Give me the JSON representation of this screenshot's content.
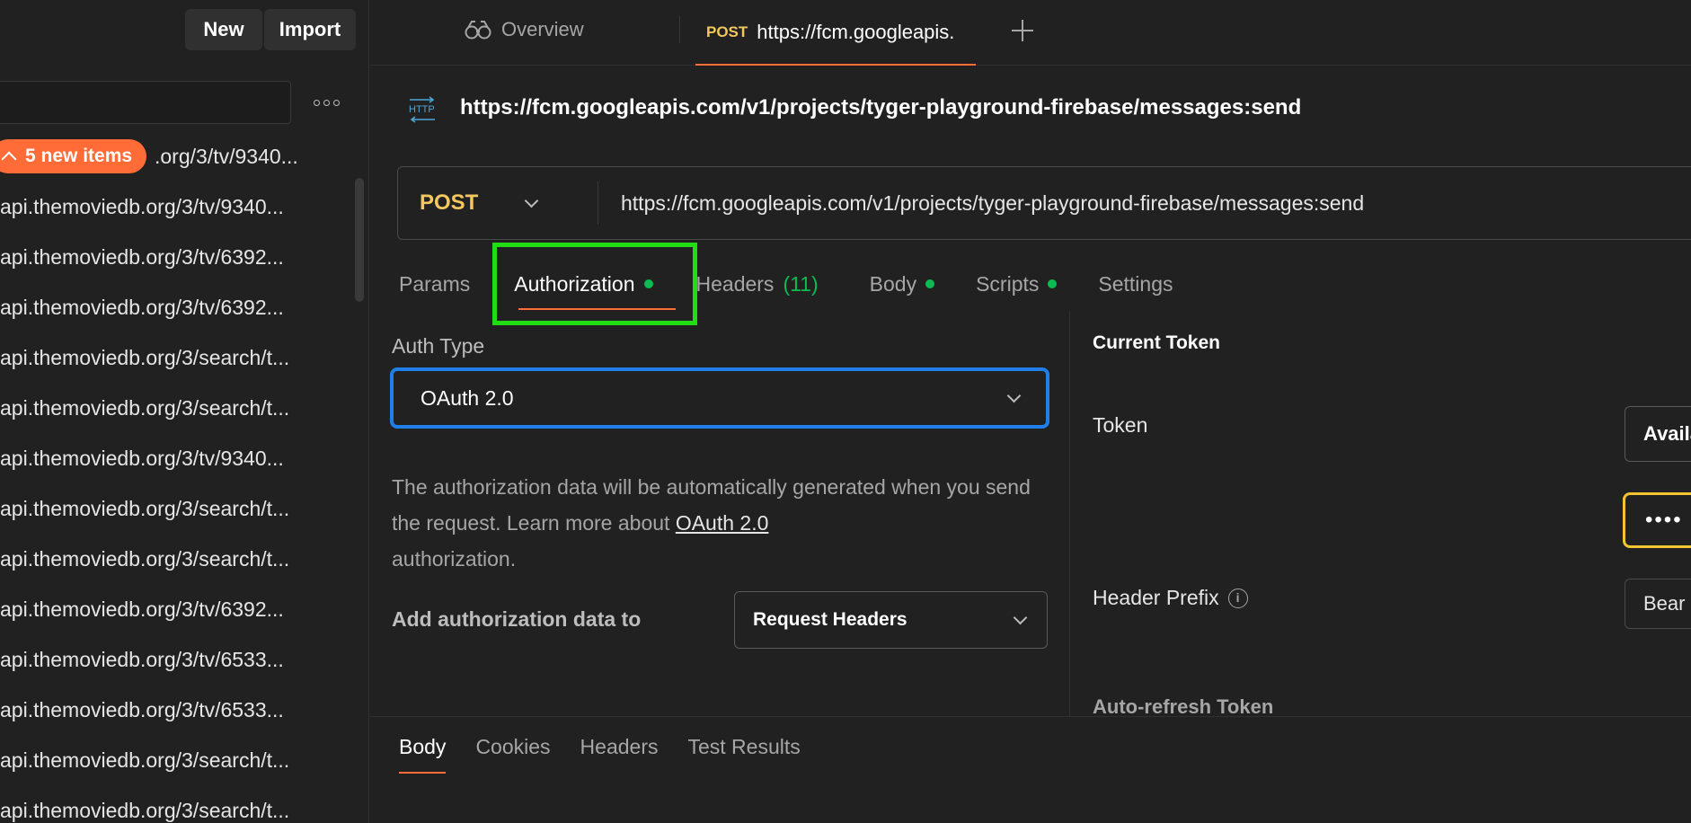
{
  "sidebar": {
    "new_button": "New",
    "import_button": "Import",
    "new_items_badge": "5 new items",
    "history": [
      ".org/3/tv/9340...",
      "api.themoviedb.org/3/tv/9340...",
      "api.themoviedb.org/3/tv/6392...",
      "api.themoviedb.org/3/tv/6392...",
      "api.themoviedb.org/3/search/t...",
      "api.themoviedb.org/3/search/t...",
      "api.themoviedb.org/3/tv/9340...",
      "api.themoviedb.org/3/search/t...",
      "api.themoviedb.org/3/search/t...",
      "api.themoviedb.org/3/tv/6392...",
      "api.themoviedb.org/3/tv/6533...",
      "api.themoviedb.org/3/tv/6533...",
      "api.themoviedb.org/3/search/t...",
      "api.themoviedb.org/3/search/t..."
    ]
  },
  "tabs": {
    "overview": "Overview",
    "active_method": "POST",
    "active_url": "https://fcm.googleapis."
  },
  "request": {
    "title": "https://fcm.googleapis.com/v1/projects/tyger-playground-firebase/messages:send",
    "method": "POST",
    "url": "https://fcm.googleapis.com/v1/projects/tyger-playground-firebase/messages:send"
  },
  "subtabs": {
    "params": "Params",
    "authorization": "Authorization",
    "headers": "Headers",
    "headers_count": "(11)",
    "body": "Body",
    "scripts": "Scripts",
    "settings": "Settings"
  },
  "auth": {
    "type_label": "Auth Type",
    "type_value": "OAuth 2.0",
    "desc_1": "The authorization data will be automatically generated when you send the request. Learn more about ",
    "desc_link": "OAuth 2.0",
    "desc_2": "authorization.",
    "add_label": "Add authorization data to",
    "add_value": "Request Headers"
  },
  "token": {
    "current_token": "Current Token",
    "token_label": "Token",
    "token_select": "Availa",
    "token_masked": "••••",
    "header_prefix_label": "Header Prefix",
    "header_prefix_value": "Bear",
    "auto_refresh": "Auto-refresh Token"
  },
  "response": {
    "tabs": [
      "Body",
      "Cookies",
      "Headers",
      "Test Results"
    ]
  },
  "colors": {
    "accent": "#ff6c37",
    "method": "#f4c65e",
    "status_dot": "#0cbb52",
    "focus_blue": "#1f7ee8",
    "highlight_green": "#22dd11",
    "token_field_yellow": "#f4c431"
  }
}
